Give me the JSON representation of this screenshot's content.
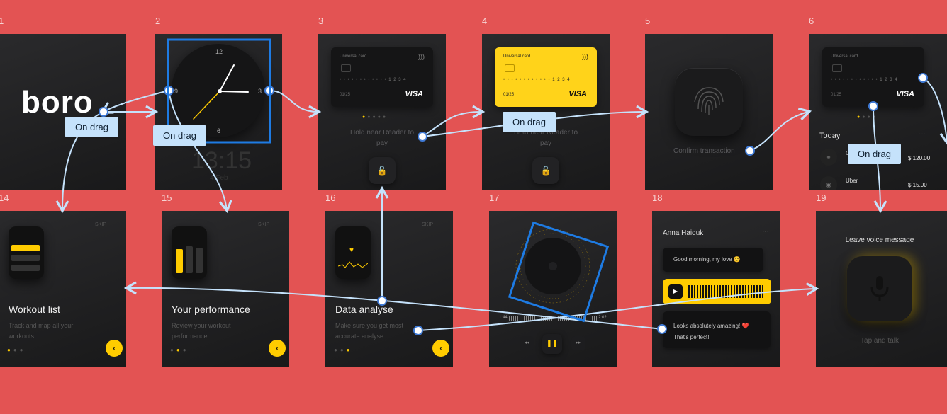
{
  "frame_numbers": [
    "1",
    "2",
    "3",
    "4",
    "5",
    "6",
    "14",
    "15",
    "16",
    "17",
    "18",
    "19"
  ],
  "labels": {
    "on_drag": "On drag"
  },
  "logo": "boro",
  "clock": {
    "n12": "12",
    "n3": "3",
    "n6": "6",
    "n9": "9",
    "time": "13:15",
    "date": "4 Feb"
  },
  "card": {
    "title": "Universal card",
    "numbers": "• • • •   • • • •   • • • •   1 2 3 4",
    "expiry": "01/25",
    "brand": "VISA"
  },
  "nfc_hint": "Hold near Reader to pay",
  "confirm": "Confirm transaction",
  "transactions": {
    "today": "Today",
    "items": [
      {
        "name": "C",
        "amount": "$ 120.00"
      },
      {
        "name": "Uber",
        "amount": "$ 15.00"
      }
    ]
  },
  "onboarding": [
    {
      "skip": "SKIP",
      "title": "Workout list",
      "subtitle": "Track and map all your workouts"
    },
    {
      "skip": "SKIP",
      "title": "Your performance",
      "subtitle": "Review your workout performance"
    },
    {
      "skip": "SKIP",
      "title": "Data analyse",
      "subtitle": "Make sure you get most accurate analyse"
    }
  ],
  "player": {
    "elapsed": "1:44",
    "total": "2:02"
  },
  "chat": {
    "name": "Anna Haiduk",
    "msg1": "Good morning, my love 😊",
    "msg2": "Looks absolutely amazing! ❤️",
    "msg3": "That's perfect!"
  },
  "voice": {
    "title": "Leave voice message",
    "hint": "Tap and talk"
  },
  "colors": {
    "background": "#e35353",
    "accent": "#ffcc00",
    "flow": "#c5e2fb",
    "selection": "#1e7be3"
  }
}
